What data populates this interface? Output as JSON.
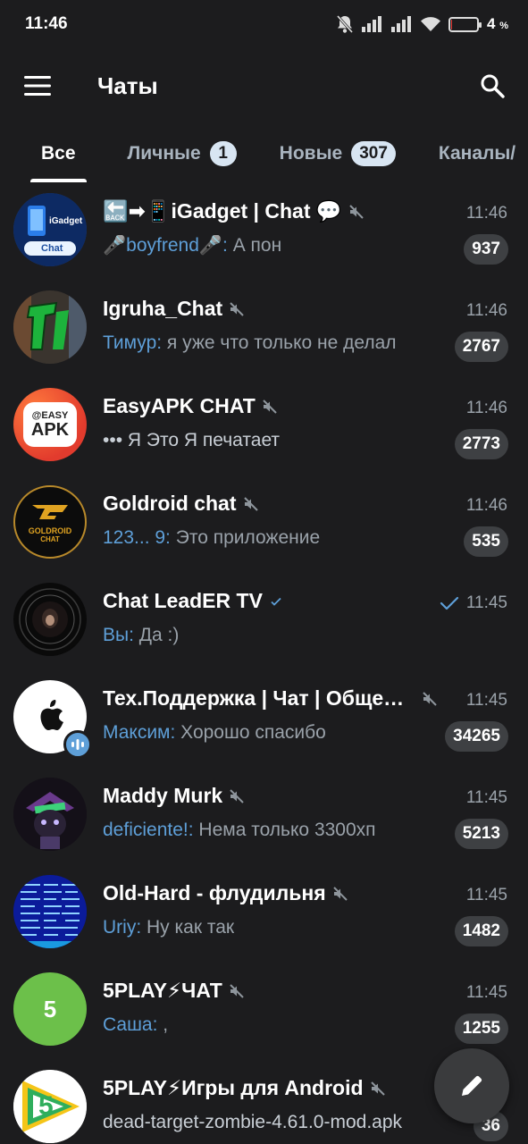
{
  "status_bar": {
    "time": "11:46",
    "battery_pct": "4",
    "battery_sign": "%",
    "battery_level": 0.04
  },
  "header": {
    "title": "Чаты"
  },
  "tabs": [
    {
      "label": "Все",
      "badge": ""
    },
    {
      "label": "Личные",
      "badge": "1"
    },
    {
      "label": "Новые",
      "badge": "307"
    },
    {
      "label": "Каналы/",
      "badge": ""
    }
  ],
  "chats": [
    {
      "title": "🔙➡📱iGadget | Chat 💬",
      "sender": "🎤boyfrend🎤:",
      "message": " А пон",
      "time": "11:46",
      "count": "937",
      "muted": true
    },
    {
      "title": "Igruha_Chat",
      "sender": "Тимур:",
      "message": " я уже что только не делал",
      "time": "11:46",
      "count": "2767",
      "muted": true
    },
    {
      "title": "EasyAPK CHAT",
      "sender": "",
      "message": "••• Я Это Я печатает",
      "time": "11:46",
      "count": "2773",
      "muted": true
    },
    {
      "title": "Goldroid chat",
      "sender": "123... 9:",
      "message": " Это приложение",
      "time": "11:46",
      "count": "535",
      "muted": true
    },
    {
      "title": "Chat LeadER TV",
      "sender": "Вы:",
      "message": " Да :)",
      "time": "11:45",
      "count": "",
      "muted": false
    },
    {
      "title": "Тех.Поддержка | Чат | Общение",
      "sender": "Максим:",
      "message": " Хорошо спасибо",
      "time": "11:45",
      "count": "34265",
      "muted": true
    },
    {
      "title": "Maddy Murk",
      "sender": "deficiente!:",
      "message": " Нема только 3300хп",
      "time": "11:45",
      "count": "5213",
      "muted": true
    },
    {
      "title": "Old-Hard - флудильня",
      "sender": "Uriy:",
      "message": " Ну как так",
      "time": "11:45",
      "count": "1482",
      "muted": true
    },
    {
      "title": "5PLAY⚡ЧАТ",
      "sender": "Саша:",
      "message": " ,",
      "time": "11:45",
      "count": "1255",
      "muted": true
    },
    {
      "title": "5PLAY⚡Игры для Android",
      "sender": "",
      "message": "dead-target-zombie-4.61.0-mod.apk",
      "time": "",
      "count": "36",
      "muted": true
    }
  ],
  "avatars": {
    "igadget": {
      "line1": "iGadget",
      "line2": "Chat"
    },
    "easyapk": {
      "line1": "@EASY",
      "line2": "APK"
    },
    "goldroid": {
      "line1": "GOLDROID",
      "line2": "CHAT"
    },
    "fiveplay_letter": "5",
    "fiveplay_games_letter": "5"
  },
  "colors": {
    "accent_blue": "#5e9fd8",
    "background": "#1c1c1e",
    "badge_gray": "#3e4043",
    "fiveplay_green": "#6cc04a"
  }
}
